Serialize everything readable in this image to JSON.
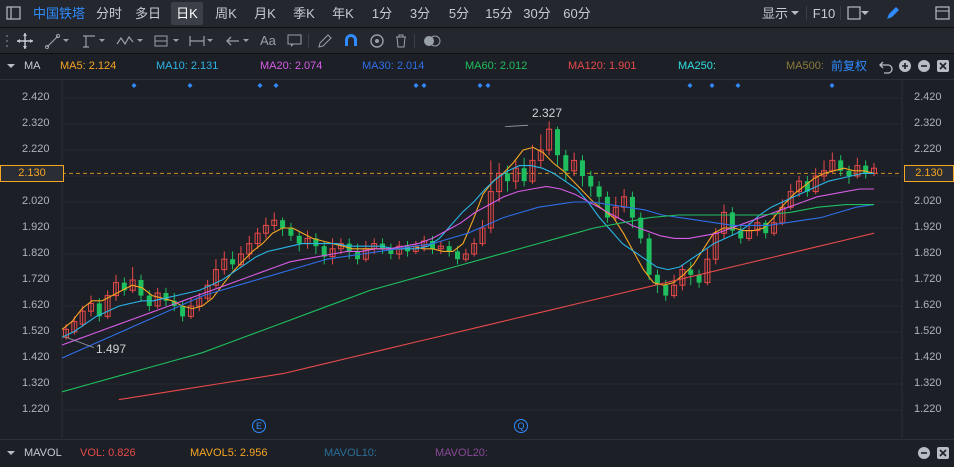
{
  "colors": {
    "up": "#e84a4a",
    "down": "#1fbf5f",
    "ma5": "#f5a623",
    "ma10": "#2bb5e6",
    "ma20": "#d65ce6",
    "ma30": "#2f6fe8",
    "ma60": "#1fbf5f",
    "ma120": "#e84a4a",
    "ma250": "#30e0e0",
    "ma500": "#8a7a3a",
    "accent": "#2f8cff"
  },
  "topbar": {
    "brand": "中国铁塔",
    "tabs": [
      "分时",
      "多日",
      "日K",
      "周K",
      "月K",
      "季K",
      "年K",
      "1分",
      "3分",
      "5分",
      "15分",
      "30分",
      "60分"
    ],
    "active_tab": "日K",
    "display_label": "显示",
    "f10_label": "F10"
  },
  "toolbar": {
    "text_tool": "Aa"
  },
  "ma_bar": {
    "title": "MA",
    "ma5": "MA5: 2.124",
    "ma10": "MA10: 2.131",
    "ma20": "MA20: 2.074",
    "ma30": "MA30: 2.014",
    "ma60": "MA60: 2.012",
    "ma120": "MA120: 1.901",
    "ma250": "MA250:",
    "ma500": "MA500:",
    "adjust": "前复权"
  },
  "price_axis": [
    "2.420",
    "2.320",
    "2.220",
    "2.120",
    "2.020",
    "1.920",
    "1.820",
    "1.720",
    "1.620",
    "1.520",
    "1.420",
    "1.320",
    "1.220"
  ],
  "current_price": "2.130",
  "annotations": {
    "high": "2.327",
    "low": "1.497"
  },
  "event_markers": [
    "E",
    "Q"
  ],
  "vol_bar": {
    "title": "MAVOL",
    "vol": "VOL: 0.826",
    "mavol5": "MAVOL5: 2.956",
    "mavol10": "MAVOL10:",
    "mavol20": "MAVOL20:"
  },
  "chart_data": {
    "type": "candlestick",
    "ylim": [
      1.19,
      2.46
    ],
    "current": 2.13,
    "candles": [
      [
        1.5,
        1.53,
        1.55,
        1.49
      ],
      [
        1.52,
        1.56,
        1.58,
        1.51
      ],
      [
        1.55,
        1.6,
        1.62,
        1.54
      ],
      [
        1.6,
        1.63,
        1.66,
        1.58
      ],
      [
        1.63,
        1.58,
        1.65,
        1.56
      ],
      [
        1.58,
        1.66,
        1.68,
        1.57
      ],
      [
        1.66,
        1.71,
        1.74,
        1.64
      ],
      [
        1.71,
        1.68,
        1.73,
        1.66
      ],
      [
        1.68,
        1.72,
        1.77,
        1.67
      ],
      [
        1.72,
        1.66,
        1.74,
        1.64
      ],
      [
        1.66,
        1.62,
        1.68,
        1.6
      ],
      [
        1.62,
        1.67,
        1.69,
        1.61
      ],
      [
        1.67,
        1.64,
        1.69,
        1.62
      ],
      [
        1.64,
        1.62,
        1.67,
        1.6
      ],
      [
        1.62,
        1.58,
        1.64,
        1.56
      ],
      [
        1.58,
        1.62,
        1.65,
        1.57
      ],
      [
        1.62,
        1.65,
        1.67,
        1.6
      ],
      [
        1.65,
        1.7,
        1.72,
        1.64
      ],
      [
        1.7,
        1.76,
        1.8,
        1.69
      ],
      [
        1.76,
        1.8,
        1.83,
        1.74
      ],
      [
        1.8,
        1.78,
        1.83,
        1.76
      ],
      [
        1.78,
        1.82,
        1.85,
        1.77
      ],
      [
        1.82,
        1.86,
        1.89,
        1.8
      ],
      [
        1.86,
        1.9,
        1.92,
        1.84
      ],
      [
        1.9,
        1.93,
        1.96,
        1.88
      ],
      [
        1.93,
        1.95,
        1.98,
        1.91
      ],
      [
        1.95,
        1.92,
        1.96,
        1.89
      ],
      [
        1.92,
        1.89,
        1.94,
        1.87
      ],
      [
        1.89,
        1.86,
        1.91,
        1.83
      ],
      [
        1.86,
        1.88,
        1.91,
        1.84
      ],
      [
        1.88,
        1.85,
        1.9,
        1.82
      ],
      [
        1.85,
        1.81,
        1.87,
        1.78
      ],
      [
        1.81,
        1.84,
        1.88,
        1.78
      ],
      [
        1.84,
        1.86,
        1.88,
        1.82
      ],
      [
        1.86,
        1.83,
        1.88,
        1.8
      ],
      [
        1.83,
        1.8,
        1.86,
        1.78
      ],
      [
        1.8,
        1.84,
        1.87,
        1.79
      ],
      [
        1.84,
        1.86,
        1.88,
        1.82
      ],
      [
        1.86,
        1.84,
        1.88,
        1.82
      ],
      [
        1.84,
        1.82,
        1.86,
        1.8
      ],
      [
        1.82,
        1.85,
        1.87,
        1.8
      ],
      [
        1.85,
        1.83,
        1.87,
        1.81
      ],
      [
        1.83,
        1.85,
        1.87,
        1.82
      ],
      [
        1.85,
        1.87,
        1.89,
        1.83
      ],
      [
        1.87,
        1.84,
        1.89,
        1.82
      ],
      [
        1.84,
        1.85,
        1.87,
        1.82
      ],
      [
        1.85,
        1.83,
        1.87,
        1.81
      ],
      [
        1.83,
        1.8,
        1.85,
        1.78
      ],
      [
        1.8,
        1.82,
        1.84,
        1.79
      ],
      [
        1.82,
        1.86,
        1.88,
        1.81
      ],
      [
        1.86,
        1.92,
        1.95,
        1.85
      ],
      [
        1.92,
        2.06,
        2.18,
        1.9
      ],
      [
        2.06,
        2.13,
        2.17,
        2.02
      ],
      [
        2.13,
        2.1,
        2.16,
        2.06
      ],
      [
        2.1,
        2.15,
        2.18,
        2.07
      ],
      [
        2.15,
        2.1,
        2.19,
        2.08
      ],
      [
        2.1,
        2.18,
        2.24,
        2.09
      ],
      [
        2.18,
        2.22,
        2.28,
        2.15
      ],
      [
        2.22,
        2.3,
        2.33,
        2.2
      ],
      [
        2.3,
        2.2,
        2.31,
        2.16
      ],
      [
        2.2,
        2.14,
        2.22,
        2.1
      ],
      [
        2.14,
        2.18,
        2.21,
        2.12
      ],
      [
        2.18,
        2.12,
        2.2,
        2.08
      ],
      [
        2.12,
        2.08,
        2.14,
        2.04
      ],
      [
        2.08,
        2.04,
        2.1,
        2.0
      ],
      [
        2.04,
        1.96,
        2.06,
        1.94
      ],
      [
        1.96,
        2.0,
        2.04,
        1.95
      ],
      [
        2.0,
        2.04,
        2.07,
        1.98
      ],
      [
        2.04,
        1.96,
        2.06,
        1.92
      ],
      [
        1.96,
        1.88,
        1.98,
        1.86
      ],
      [
        1.88,
        1.74,
        1.9,
        1.72
      ],
      [
        1.74,
        1.7,
        1.76,
        1.67
      ],
      [
        1.7,
        1.66,
        1.72,
        1.64
      ],
      [
        1.66,
        1.7,
        1.74,
        1.65
      ],
      [
        1.7,
        1.76,
        1.78,
        1.68
      ],
      [
        1.76,
        1.74,
        1.79,
        1.7
      ],
      [
        1.74,
        1.71,
        1.76,
        1.69
      ],
      [
        1.71,
        1.8,
        1.84,
        1.7
      ],
      [
        1.8,
        1.9,
        1.92,
        1.78
      ],
      [
        1.9,
        1.98,
        2.01,
        1.88
      ],
      [
        1.98,
        1.91,
        2.0,
        1.89
      ],
      [
        1.91,
        1.88,
        1.93,
        1.86
      ],
      [
        1.88,
        1.91,
        1.94,
        1.87
      ],
      [
        1.91,
        1.94,
        1.96,
        1.89
      ],
      [
        1.94,
        1.9,
        1.95,
        1.88
      ],
      [
        1.9,
        1.94,
        1.97,
        1.89
      ],
      [
        1.94,
        2.0,
        2.03,
        1.93
      ],
      [
        2.0,
        2.06,
        2.09,
        1.99
      ],
      [
        2.06,
        2.1,
        2.12,
        2.04
      ],
      [
        2.1,
        2.06,
        2.12,
        2.04
      ],
      [
        2.06,
        2.12,
        2.15,
        2.05
      ],
      [
        2.12,
        2.14,
        2.18,
        2.1
      ],
      [
        2.14,
        2.18,
        2.21,
        2.13
      ],
      [
        2.18,
        2.14,
        2.2,
        2.12
      ],
      [
        2.14,
        2.12,
        2.16,
        2.09
      ],
      [
        2.12,
        2.16,
        2.19,
        2.11
      ],
      [
        2.16,
        2.13,
        2.18,
        2.11
      ],
      [
        2.13,
        2.15,
        2.17,
        2.12
      ]
    ],
    "ma_lines": {
      "ma5": [
        1.53,
        1.56,
        1.61,
        1.64,
        1.64,
        1.66,
        1.68,
        1.7,
        1.69,
        1.66,
        1.65,
        1.64,
        1.62,
        1.61,
        1.62,
        1.65,
        1.7,
        1.75,
        1.79,
        1.83,
        1.86,
        1.9,
        1.92,
        1.92,
        1.9,
        1.88,
        1.87,
        1.86,
        1.85,
        1.84,
        1.84,
        1.84,
        1.84,
        1.84,
        1.84,
        1.85,
        1.84,
        1.84,
        1.83,
        1.83,
        1.86,
        1.95,
        2.05,
        2.1,
        2.13,
        2.17,
        2.22,
        2.23,
        2.21,
        2.17,
        2.14,
        2.1,
        2.06,
        2.02,
        1.99,
        1.96,
        1.9,
        1.83,
        1.76,
        1.71,
        1.7,
        1.71,
        1.74,
        1.78,
        1.84,
        1.9,
        1.92,
        1.92,
        1.91,
        1.91,
        1.92,
        1.96,
        2.01,
        2.05,
        2.08,
        2.11,
        2.13,
        2.14,
        2.15,
        2.14,
        2.14,
        2.13
      ],
      "ma10": [
        1.5,
        1.52,
        1.55,
        1.58,
        1.6,
        1.62,
        1.63,
        1.64,
        1.64,
        1.65,
        1.66,
        1.67,
        1.68,
        1.7,
        1.72,
        1.75,
        1.78,
        1.81,
        1.83,
        1.84,
        1.85,
        1.86,
        1.86,
        1.86,
        1.86,
        1.85,
        1.85,
        1.85,
        1.85,
        1.84,
        1.84,
        1.84,
        1.85,
        1.88,
        1.93,
        1.98,
        2.02,
        2.07,
        2.11,
        2.14,
        2.16,
        2.16,
        2.15,
        2.13,
        2.1,
        2.07,
        2.02,
        1.96,
        1.91,
        1.86,
        1.83,
        1.8,
        1.77,
        1.76,
        1.77,
        1.8,
        1.83,
        1.86,
        1.88,
        1.9,
        1.93,
        1.97,
        2.0,
        2.02,
        2.04,
        2.06,
        2.08,
        2.1,
        2.11,
        2.12,
        2.13,
        2.13
      ],
      "ma20": [
        1.47,
        1.49,
        1.51,
        1.53,
        1.55,
        1.57,
        1.59,
        1.61,
        1.63,
        1.65,
        1.67,
        1.69,
        1.71,
        1.73,
        1.75,
        1.77,
        1.79,
        1.8,
        1.81,
        1.82,
        1.83,
        1.83,
        1.84,
        1.84,
        1.85,
        1.86,
        1.88,
        1.91,
        1.94,
        1.98,
        2.01,
        2.04,
        2.06,
        2.07,
        2.08,
        2.07,
        2.05,
        2.02,
        1.99,
        1.96,
        1.93,
        1.91,
        1.89,
        1.88,
        1.88,
        1.89,
        1.9,
        1.92,
        1.94,
        1.96,
        1.98,
        2.0,
        2.02,
        2.04,
        2.05,
        2.06,
        2.07,
        2.07
      ],
      "ma30": [
        1.42,
        1.45,
        1.48,
        1.51,
        1.54,
        1.57,
        1.6,
        1.63,
        1.66,
        1.68,
        1.7,
        1.72,
        1.74,
        1.76,
        1.78,
        1.8,
        1.81,
        1.82,
        1.83,
        1.84,
        1.85,
        1.86,
        1.88,
        1.9,
        1.93,
        1.96,
        1.98,
        2.0,
        2.01,
        2.02,
        2.02,
        2.01,
        2.0,
        1.99,
        1.97,
        1.96,
        1.95,
        1.94,
        1.93,
        1.93,
        1.93,
        1.94,
        1.95,
        1.96,
        1.98,
        2.0,
        2.01
      ],
      "ma60": [
        1.29,
        1.32,
        1.35,
        1.38,
        1.41,
        1.44,
        1.48,
        1.52,
        1.56,
        1.6,
        1.64,
        1.68,
        1.71,
        1.74,
        1.77,
        1.8,
        1.83,
        1.86,
        1.89,
        1.92,
        1.94,
        1.96,
        1.97,
        1.97,
        1.97,
        1.97,
        1.98,
        2.0,
        2.01,
        2.01
      ],
      "ma120": [
        1.26,
        1.28,
        1.3,
        1.32,
        1.34,
        1.36,
        1.39,
        1.42,
        1.45,
        1.48,
        1.51,
        1.54,
        1.57,
        1.6,
        1.63,
        1.66,
        1.69,
        1.72,
        1.75,
        1.78,
        1.81,
        1.84,
        1.87,
        1.9
      ]
    }
  }
}
